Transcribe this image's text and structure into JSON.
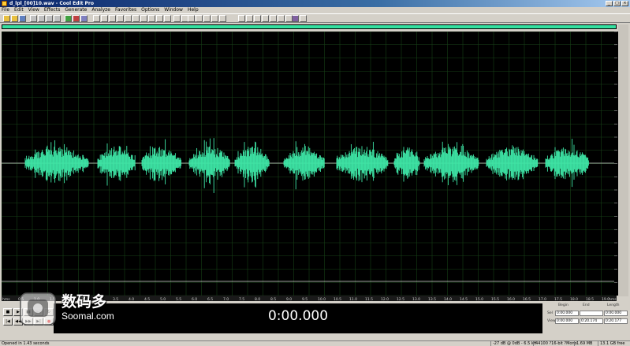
{
  "window": {
    "title": "d_lpl_[00]10.wav - Cool Edit Pro"
  },
  "menu": [
    "File",
    "Edit",
    "View",
    "Effects",
    "Generate",
    "Analyze",
    "Favorites",
    "Options",
    "Window",
    "Help"
  ],
  "toolbar": {
    "icons": [
      "new-icon",
      "open-icon",
      "save-icon",
      "cut-icon",
      "copy-icon",
      "paste-icon",
      "mix-paste-icon",
      "zoom-icon",
      "spectral-icon",
      "settings-icon",
      "cursor-icon",
      "select-icon",
      "scrub-icon",
      "multitrack-icon",
      "cd-icon"
    ]
  },
  "colors": {
    "waveform": "#3ee6a6",
    "grid": "#174017",
    "background": "#000000",
    "overview": "#35e0a0"
  },
  "ruler": {
    "labels": [
      "dB",
      "-27000",
      "24000",
      "21000",
      "18000",
      "15000",
      "12000",
      "9000",
      "6000",
      "3000",
      "0",
      "-3000",
      "-6000",
      "-9000",
      "-12000",
      "-15000",
      "-18000",
      "-21000",
      "-24000",
      "-27000",
      "smpl"
    ]
  },
  "timeline": {
    "labels": [
      "hms",
      "0.5",
      "1.0",
      "1.5",
      "2.0",
      "2.5",
      "3.0",
      "3.5",
      "4.0",
      "4.5",
      "5.0",
      "5.5",
      "6.0",
      "6.5",
      "7.0",
      "7.5",
      "8.0",
      "8.5",
      "9.0",
      "9.5",
      "10.0",
      "10.5",
      "11.0",
      "11.5",
      "12.0",
      "12.5",
      "13.0",
      "13.5",
      "14.0",
      "14.5",
      "15.0",
      "15.5",
      "16.0",
      "16.5",
      "17.0",
      "17.5",
      "18.0",
      "18.5",
      "19.0",
      "hms"
    ]
  },
  "transport": {
    "buttons": [
      "stop",
      "play",
      "pause",
      "play-to-end",
      "loop",
      "record",
      "go-start",
      "rewind",
      "fast-forward",
      "go-end"
    ]
  },
  "time_display": "0:00.000",
  "selection": {
    "headers": [
      "Begin",
      "End",
      "Length"
    ],
    "rows": [
      {
        "label": "Sel",
        "values": [
          "0:00.000",
          "",
          "0:00.000"
        ]
      },
      {
        "label": "View",
        "values": [
          "0:00.000",
          "0:20.174",
          "0:20.177"
        ]
      }
    ]
  },
  "status": {
    "left": "Opened in 1.43 seconds",
    "db": "-27 dB @ 0dB - 6.5 kH",
    "format": "44100 ?16-bit ?Mono",
    "size": "1.69 MB",
    "free": "13.1 GB free"
  },
  "watermark": {
    "cn": "数码多",
    "en": "Soomal.com"
  }
}
